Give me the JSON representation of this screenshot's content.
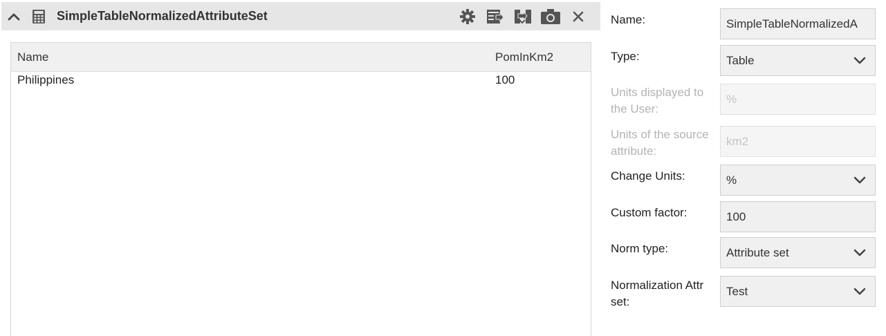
{
  "panel": {
    "title": "SimpleTableNormalizedAttributeSet",
    "icons": [
      "collapse-chevron-up-icon",
      "calculator-icon",
      "gear-icon",
      "export-table-icon",
      "import-icon",
      "camera-icon",
      "close-icon"
    ]
  },
  "table": {
    "columns": [
      "Name",
      "PomInKm2"
    ],
    "rows": [
      [
        "Philippines",
        "100"
      ]
    ]
  },
  "form": {
    "name_label": "Name:",
    "name_value": "SimpleTableNormalizedA",
    "type_label": "Type:",
    "type_value": "Table",
    "units_displayed_label": "Units displayed to the User:",
    "units_displayed_value": "%",
    "units_source_label": "Units of the source attribute:",
    "units_source_value": "km2",
    "change_units_label": "Change Units:",
    "change_units_value": "%",
    "custom_factor_label": "Custom factor:",
    "custom_factor_value": "100",
    "norm_type_label": "Norm type:",
    "norm_type_value": "Attribute set",
    "norm_attr_label": "Normalization Attr set:",
    "norm_attr_value": "Test"
  },
  "colors": {
    "header_bg": "#e6e6e6",
    "field_bg": "#f0f0f0",
    "disabled_text": "#b3b3b3"
  }
}
